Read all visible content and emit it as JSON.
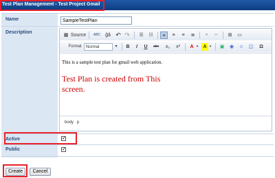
{
  "header": {
    "title": "Test Plan Management - Test Project Gmail"
  },
  "form": {
    "name_label": "Name",
    "name_value": "SampleTestPlan",
    "description_label": "Description",
    "active_label": "Active",
    "active_checked": true,
    "public_label": "Public",
    "public_checked": true
  },
  "editor": {
    "toolbar1": {
      "source": "Source",
      "spell": "ABC",
      "find": "ĝă",
      "undo": "↶",
      "redo": "↷"
    },
    "toolbar2": {
      "format": "Format",
      "format_value": "Normal",
      "bold": "B",
      "italic": "I",
      "underline": "U",
      "strike": "abc",
      "subscript": "x₂",
      "superscript": "x²",
      "text_color": "A",
      "bg_color": "A"
    },
    "content_line": "This is a sample test plan for gmail web application.",
    "annotation_line1": "Test Plan is created from This",
    "annotation_line2": "screen.",
    "path1": "body",
    "path2": "p"
  },
  "buttons": {
    "create": "Create",
    "cancel": "Cancel"
  },
  "colors": {
    "header": "#0d3d80",
    "highlight": "#e8202a",
    "label_bg": "#dce7f4"
  }
}
